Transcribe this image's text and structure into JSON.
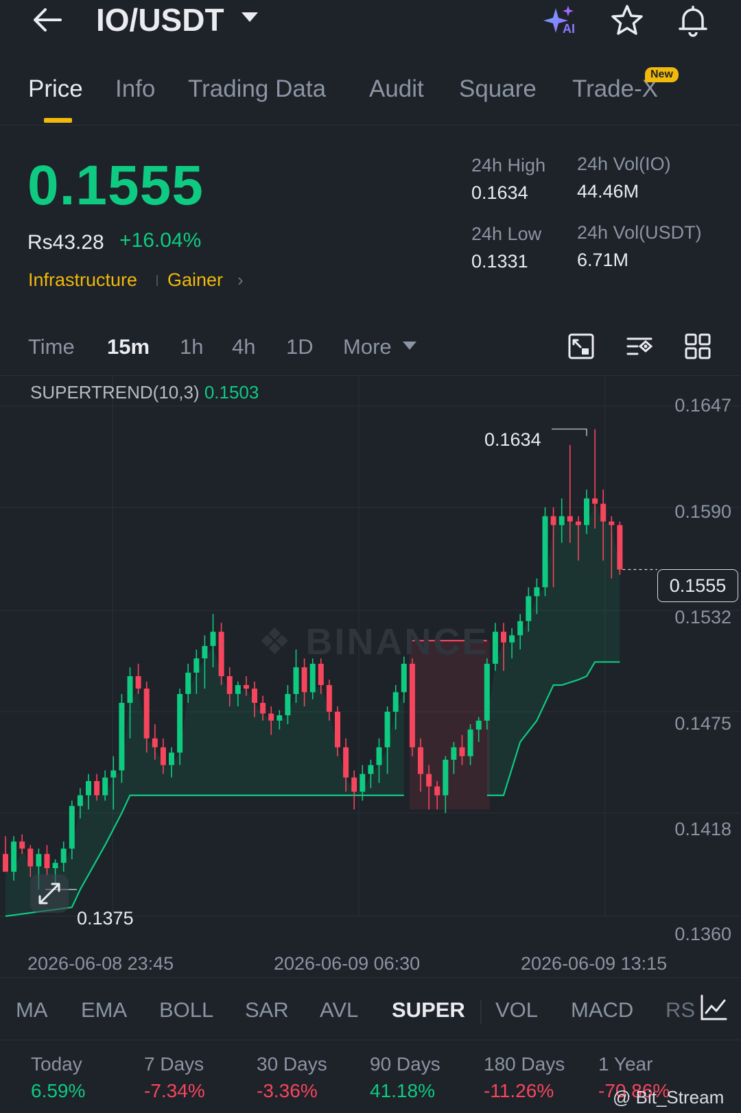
{
  "header": {
    "pair": "IO/USDT",
    "ai_label": "AI"
  },
  "tabs": [
    {
      "label": "Price",
      "active": true
    },
    {
      "label": "Info"
    },
    {
      "label": "Trading Data"
    },
    {
      "label": "Audit"
    },
    {
      "label": "Square"
    },
    {
      "label": "Trade-X",
      "badge": "New"
    }
  ],
  "ticker": {
    "last_price": "0.1555",
    "fiat_price": "Rs43.28",
    "change_pct": "+16.04%",
    "tags": [
      "Infrastructure",
      "Gainer"
    ],
    "stats": [
      {
        "label": "24h High",
        "value": "0.1634"
      },
      {
        "label": "24h Vol(IO)",
        "value": "44.46M"
      },
      {
        "label": "24h Low",
        "value": "0.1331"
      },
      {
        "label": "24h Vol(USDT)",
        "value": "6.71M"
      }
    ]
  },
  "timeframes": [
    {
      "label": "Time"
    },
    {
      "label": "15m",
      "active": true
    },
    {
      "label": "1h"
    },
    {
      "label": "4h"
    },
    {
      "label": "1D"
    },
    {
      "label": "More"
    }
  ],
  "chart_data": {
    "type": "candlestick",
    "watermark": "BINANCE",
    "indicator": {
      "name": "SUPERTREND(10,3)",
      "value": "0.1503"
    },
    "y_ticks": [
      "0.1647",
      "0.1590",
      "0.1532",
      "0.1475",
      "0.1418",
      "0.1360"
    ],
    "ylim": [
      0.136,
      0.1647
    ],
    "x_ticks": [
      "2026-06-08 23:45",
      "2026-06-09 06:30",
      "2026-06-09 13:15"
    ],
    "current_price": "0.1555",
    "high_marker": "0.1634",
    "low_marker": "0.1375",
    "colors": {
      "up": "#0ecb81",
      "down": "#f6465d"
    },
    "candles": [
      [
        0.1395,
        0.1405,
        0.1385,
        0.1385
      ],
      [
        0.1385,
        0.1405,
        0.138,
        0.1402
      ],
      [
        0.1402,
        0.1406,
        0.1395,
        0.1398
      ],
      [
        0.1398,
        0.14,
        0.1382,
        0.1388
      ],
      [
        0.1388,
        0.1398,
        0.1375,
        0.1395
      ],
      [
        0.1395,
        0.14,
        0.1383,
        0.1387
      ],
      [
        0.1387,
        0.1392,
        0.1378,
        0.139
      ],
      [
        0.139,
        0.1402,
        0.1385,
        0.1398
      ],
      [
        0.1398,
        0.1425,
        0.1392,
        0.1422
      ],
      [
        0.1422,
        0.1432,
        0.1415,
        0.1428
      ],
      [
        0.1428,
        0.144,
        0.142,
        0.1436
      ],
      [
        0.1436,
        0.144,
        0.1425,
        0.1428
      ],
      [
        0.1428,
        0.1442,
        0.1425,
        0.1438
      ],
      [
        0.1438,
        0.145,
        0.142,
        0.1442
      ],
      [
        0.1442,
        0.1485,
        0.1435,
        0.148
      ],
      [
        0.148,
        0.15,
        0.146,
        0.1495
      ],
      [
        0.1495,
        0.1502,
        0.1485,
        0.1488
      ],
      [
        0.1488,
        0.1492,
        0.1452,
        0.146
      ],
      [
        0.146,
        0.1468,
        0.1448,
        0.1455
      ],
      [
        0.1455,
        0.146,
        0.144,
        0.1445
      ],
      [
        0.1445,
        0.1455,
        0.1438,
        0.1452
      ],
      [
        0.1452,
        0.1488,
        0.1445,
        0.1485
      ],
      [
        0.1485,
        0.1502,
        0.148,
        0.1497
      ],
      [
        0.1497,
        0.151,
        0.1485,
        0.1505
      ],
      [
        0.1505,
        0.1518,
        0.1488,
        0.1512
      ],
      [
        0.1512,
        0.153,
        0.15,
        0.152
      ],
      [
        0.152,
        0.1525,
        0.149,
        0.1495
      ],
      [
        0.1495,
        0.15,
        0.1478,
        0.1485
      ],
      [
        0.1485,
        0.1492,
        0.1478,
        0.149
      ],
      [
        0.149,
        0.1495,
        0.1484,
        0.1488
      ],
      [
        0.1488,
        0.1492,
        0.1472,
        0.148
      ],
      [
        0.148,
        0.1484,
        0.147,
        0.1474
      ],
      [
        0.1474,
        0.1478,
        0.1462,
        0.147
      ],
      [
        0.147,
        0.1476,
        0.1465,
        0.1473
      ],
      [
        0.1473,
        0.149,
        0.1468,
        0.1485
      ],
      [
        0.1485,
        0.151,
        0.148,
        0.15
      ],
      [
        0.15,
        0.1505,
        0.1478,
        0.1486
      ],
      [
        0.1486,
        0.1505,
        0.1482,
        0.1502
      ],
      [
        0.1502,
        0.1505,
        0.1485,
        0.149
      ],
      [
        0.149,
        0.1493,
        0.147,
        0.1475
      ],
      [
        0.1475,
        0.1478,
        0.145,
        0.1455
      ],
      [
        0.1455,
        0.146,
        0.143,
        0.1438
      ],
      [
        0.1438,
        0.1442,
        0.142,
        0.143
      ],
      [
        0.143,
        0.1445,
        0.1425,
        0.144
      ],
      [
        0.144,
        0.1448,
        0.1432,
        0.1445
      ],
      [
        0.1445,
        0.146,
        0.1435,
        0.1455
      ],
      [
        0.1455,
        0.1478,
        0.144,
        0.1475
      ],
      [
        0.1475,
        0.149,
        0.1465,
        0.1486
      ],
      [
        0.1486,
        0.1506,
        0.148,
        0.1502
      ],
      [
        0.1502,
        0.1505,
        0.145,
        0.1455
      ],
      [
        0.1455,
        0.146,
        0.143,
        0.144
      ],
      [
        0.144,
        0.1445,
        0.142,
        0.1433
      ],
      [
        0.1433,
        0.1436,
        0.142,
        0.1428
      ],
      [
        0.1428,
        0.145,
        0.1418,
        0.1448
      ],
      [
        0.1448,
        0.1458,
        0.144,
        0.1455
      ],
      [
        0.1455,
        0.1462,
        0.1445,
        0.145
      ],
      [
        0.145,
        0.1468,
        0.1445,
        0.1465
      ],
      [
        0.1465,
        0.1472,
        0.1458,
        0.147
      ],
      [
        0.147,
        0.1505,
        0.1465,
        0.1502
      ],
      [
        0.1502,
        0.1525,
        0.1498,
        0.152
      ],
      [
        0.152,
        0.1525,
        0.1498,
        0.1514
      ],
      [
        0.1514,
        0.1522,
        0.1505,
        0.1518
      ],
      [
        0.1518,
        0.153,
        0.151,
        0.1526
      ],
      [
        0.1526,
        0.1545,
        0.152,
        0.154
      ],
      [
        0.154,
        0.155,
        0.153,
        0.1545
      ],
      [
        0.1545,
        0.159,
        0.154,
        0.1585
      ],
      [
        0.1585,
        0.159,
        0.1545,
        0.158
      ],
      [
        0.158,
        0.1595,
        0.157,
        0.1585
      ],
      [
        0.1585,
        0.1625,
        0.157,
        0.1582
      ],
      [
        0.1582,
        0.1585,
        0.156,
        0.158
      ],
      [
        0.158,
        0.16,
        0.1575,
        0.1595
      ],
      [
        0.1595,
        0.1634,
        0.1578,
        0.1592
      ],
      [
        0.1592,
        0.16,
        0.156,
        0.1582
      ],
      [
        0.1582,
        0.1585,
        0.155,
        0.158
      ],
      [
        0.158,
        0.1582,
        0.1552,
        0.1555
      ]
    ],
    "supertrend_down": [
      [
        49,
        0.1515
      ],
      [
        58,
        0.1515
      ]
    ],
    "supertrend_up": [
      [
        0,
        0.136
      ],
      [
        8,
        0.1365
      ],
      [
        9,
        0.1375
      ],
      [
        12,
        0.14
      ],
      [
        14,
        0.1418
      ],
      [
        15,
        0.1428
      ],
      [
        48,
        0.1428
      ]
    ],
    "supertrend_up2": [
      [
        58,
        0.1428
      ],
      [
        60,
        0.1428
      ],
      [
        62,
        0.1458
      ],
      [
        64,
        0.147
      ],
      [
        66,
        0.149
      ],
      [
        67,
        0.149
      ],
      [
        69,
        0.1493
      ],
      [
        70,
        0.1495
      ],
      [
        71,
        0.1503
      ],
      [
        74,
        0.1503
      ]
    ]
  },
  "indicators": [
    {
      "label": "MA"
    },
    {
      "label": "EMA"
    },
    {
      "label": "BOLL"
    },
    {
      "label": "SAR"
    },
    {
      "label": "AVL"
    },
    {
      "label": "SUPER",
      "active": true
    },
    {
      "label": "VOL"
    },
    {
      "label": "MACD"
    },
    {
      "label": "RS"
    }
  ],
  "performance": [
    {
      "label": "Today",
      "value": "6.59%",
      "positive": true
    },
    {
      "label": "7 Days",
      "value": "-7.34%",
      "positive": false
    },
    {
      "label": "30 Days",
      "value": "-3.36%",
      "positive": false
    },
    {
      "label": "90 Days",
      "value": "41.18%",
      "positive": true
    },
    {
      "label": "180 Days",
      "value": "-11.26%",
      "positive": false
    },
    {
      "label": "1 Year",
      "value": "-70.86%",
      "positive": false
    }
  ],
  "credit": "@ Bit_Stream"
}
